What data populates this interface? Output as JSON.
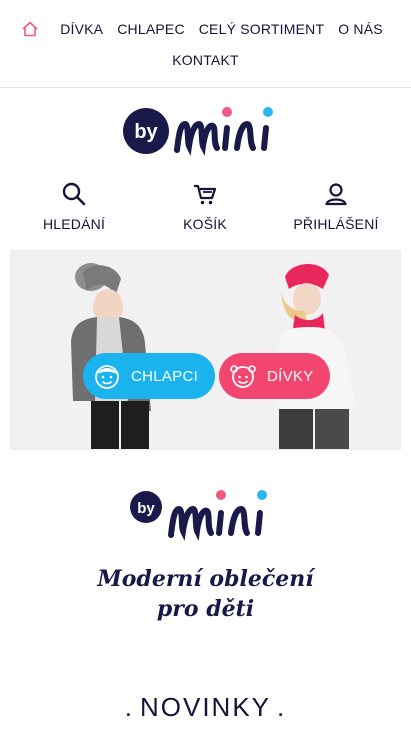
{
  "nav": {
    "home_icon": "home-icon",
    "items": [
      "DÍVKA",
      "CHLAPEC",
      "CELÝ SORTIMENT",
      "O NÁS"
    ],
    "second_row": "KONTAKT"
  },
  "logo": {
    "by": "by",
    "mini": "mini"
  },
  "actions": [
    {
      "icon": "search-icon",
      "label": "HLEDÁNÍ"
    },
    {
      "icon": "cart-icon",
      "label": "KOŠÍK"
    },
    {
      "icon": "user-icon",
      "label": "PŘIHLÁŠENÍ"
    }
  ],
  "hero": {
    "boys_label": "CHLAPCI",
    "girls_label": "DÍVKY"
  },
  "brand": {
    "tagline_line1": "Moderní oblečení",
    "tagline_line2": "pro děti"
  },
  "section": {
    "title": "NOVINKY"
  },
  "colors": {
    "navy": "#14143a",
    "pink": "#f2456f",
    "blue": "#1ab3ee",
    "home_icon": "#f05a7e"
  }
}
